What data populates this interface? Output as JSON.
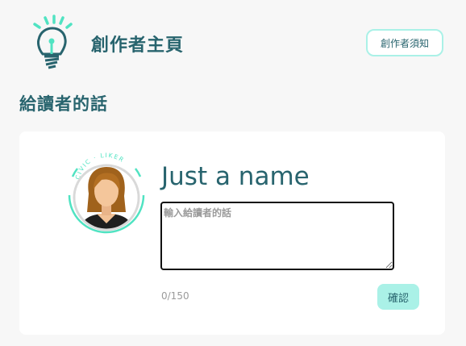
{
  "header": {
    "title": "創作者主頁",
    "notice_button": "創作者須知"
  },
  "section": {
    "title": "給讀者的話"
  },
  "profile": {
    "badge_text": "CIVIC · LIKER",
    "name": "Just a name"
  },
  "message": {
    "placeholder": "輸入給讀者的話",
    "value": "",
    "char_count": "0/150"
  },
  "actions": {
    "confirm": "確認"
  },
  "colors": {
    "accent": "#aaf1e7",
    "brand_dark": "#28646e",
    "ring": "#50e3c2"
  }
}
